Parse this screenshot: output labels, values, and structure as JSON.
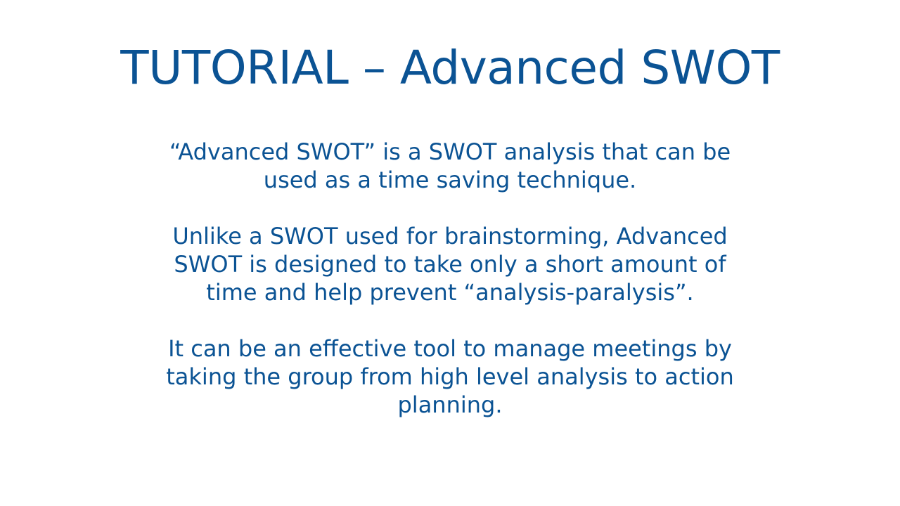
{
  "slide": {
    "title": "TUTORIAL – Advanced SWOT",
    "paragraphs": [
      {
        "lines": [
          "“Advanced SWOT” is a SWOT analysis that can be",
          "used as a time saving technique."
        ]
      },
      {
        "lines": [
          "Unlike a SWOT used for brainstorming, Advanced",
          "SWOT is designed to take only a short amount of",
          "time and help prevent “analysis-paralysis”."
        ]
      },
      {
        "lines": [
          "It can be an effective tool to manage meetings by",
          "taking the group from high level analysis to action",
          "planning."
        ]
      }
    ]
  },
  "colors": {
    "text": "#0b5394",
    "background": "#ffffff"
  }
}
